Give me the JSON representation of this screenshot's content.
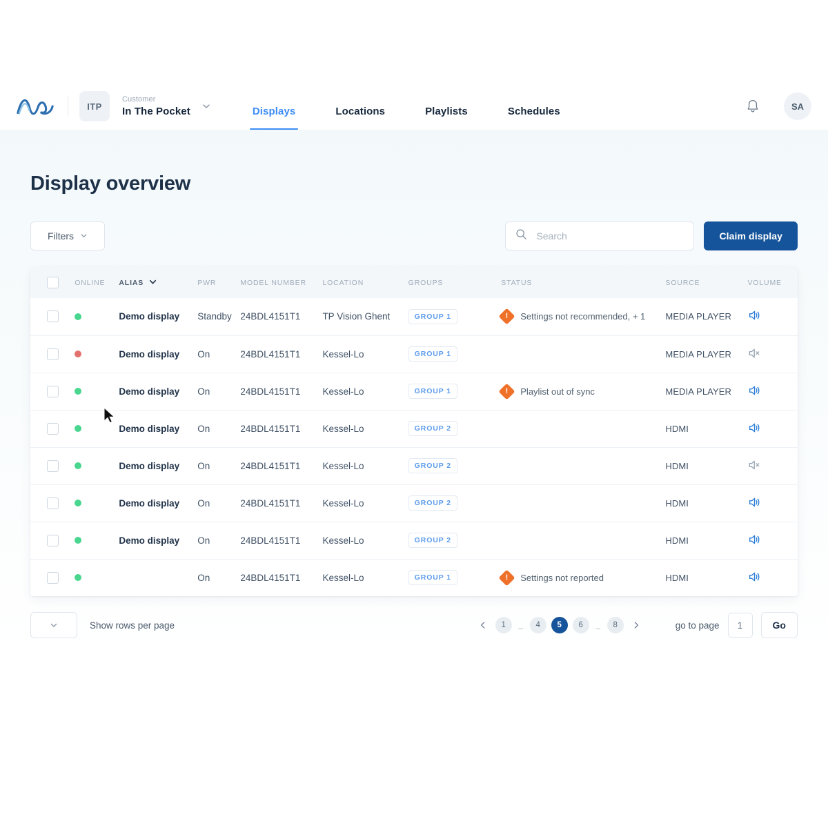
{
  "header": {
    "logo_name": "wave-logo",
    "customer_badge": "ITP",
    "customer_label": "Customer",
    "customer_name": "In The Pocket",
    "tabs": [
      {
        "label": "Displays",
        "active": true
      },
      {
        "label": "Locations",
        "active": false
      },
      {
        "label": "Playlists",
        "active": false
      },
      {
        "label": "Schedules",
        "active": false
      }
    ],
    "notifications_icon": "bell-icon",
    "avatar_initials": "SA"
  },
  "page": {
    "title": "Display overview"
  },
  "toolbar": {
    "filters_label": "Filters",
    "search_placeholder": "Search",
    "search_value": "",
    "claim_label": "Claim display"
  },
  "table": {
    "columns": [
      {
        "key": "check",
        "label": ""
      },
      {
        "key": "online",
        "label": "ONLINE"
      },
      {
        "key": "alias",
        "label": "ALIAS",
        "sortable": true
      },
      {
        "key": "pwr",
        "label": "PWR"
      },
      {
        "key": "model",
        "label": "MODEL NUMBER"
      },
      {
        "key": "loc",
        "label": "LOCATION"
      },
      {
        "key": "groups",
        "label": "GROUPS"
      },
      {
        "key": "status",
        "label": "STATUS"
      },
      {
        "key": "source",
        "label": "SOURCE"
      },
      {
        "key": "volume",
        "label": "VOLUME"
      }
    ],
    "rows": [
      {
        "checked": false,
        "online": "online",
        "alias": "Demo display",
        "pwr": "Standby",
        "model": "24BDL4151T1",
        "location": "TP Vision Ghent",
        "group": "GROUP 1",
        "status": "Settings not recommended, + 1",
        "has_warning": true,
        "source": "MEDIA PLAYER",
        "volume": "on"
      },
      {
        "checked": false,
        "online": "offline",
        "alias": "Demo display",
        "pwr": "On",
        "model": "24BDL4151T1",
        "location": "Kessel-Lo",
        "group": "GROUP 1",
        "status": "",
        "has_warning": false,
        "source": "MEDIA PLAYER",
        "volume": "muted"
      },
      {
        "checked": false,
        "online": "online",
        "alias": "Demo display",
        "pwr": "On",
        "model": "24BDL4151T1",
        "location": "Kessel-Lo",
        "group": "GROUP 1",
        "status": "Playlist out of sync",
        "has_warning": true,
        "source": "MEDIA PLAYER",
        "volume": "on"
      },
      {
        "checked": false,
        "online": "online",
        "alias": "Demo display",
        "pwr": "On",
        "model": "24BDL4151T1",
        "location": "Kessel-Lo",
        "group": "GROUP 2",
        "status": "",
        "has_warning": false,
        "source": "HDMI",
        "volume": "on"
      },
      {
        "checked": false,
        "online": "online",
        "alias": "Demo display",
        "pwr": "On",
        "model": "24BDL4151T1",
        "location": "Kessel-Lo",
        "group": "GROUP 2",
        "status": "",
        "has_warning": false,
        "source": "HDMI",
        "volume": "muted"
      },
      {
        "checked": false,
        "online": "online",
        "alias": "Demo display",
        "pwr": "On",
        "model": "24BDL4151T1",
        "location": "Kessel-Lo",
        "group": "GROUP 2",
        "status": "",
        "has_warning": false,
        "source": "HDMI",
        "volume": "on"
      },
      {
        "checked": false,
        "online": "online",
        "alias": "Demo display",
        "pwr": "On",
        "model": "24BDL4151T1",
        "location": "Kessel-Lo",
        "group": "GROUP 2",
        "status": "",
        "has_warning": false,
        "source": "HDMI",
        "volume": "on"
      },
      {
        "checked": false,
        "online": "online",
        "alias": "",
        "pwr": "On",
        "model": "24BDL4151T1",
        "location": "Kessel-Lo",
        "group": "GROUP 1",
        "status": "Settings not reported",
        "has_warning": true,
        "source": "HDMI",
        "volume": "on"
      }
    ]
  },
  "footer": {
    "rows_per_page_value": "",
    "rows_per_page_label": "Show rows per page",
    "pages": [
      {
        "label": "1",
        "active": false,
        "gap": false
      },
      {
        "label": "_",
        "active": false,
        "gap": true
      },
      {
        "label": "4",
        "active": false,
        "gap": false
      },
      {
        "label": "5",
        "active": true,
        "gap": false
      },
      {
        "label": "6",
        "active": false,
        "gap": false
      },
      {
        "label": "_",
        "active": false,
        "gap": true
      },
      {
        "label": "8",
        "active": false,
        "gap": false
      }
    ],
    "goto_label": "go to page",
    "goto_value": "1",
    "go_label": "Go"
  },
  "colors": {
    "brand_blue": "#15549a",
    "accent_blue": "#3d8df5",
    "online_green": "#49d68e",
    "offline_red": "#e2716e",
    "warning_orange": "#ef7028"
  }
}
